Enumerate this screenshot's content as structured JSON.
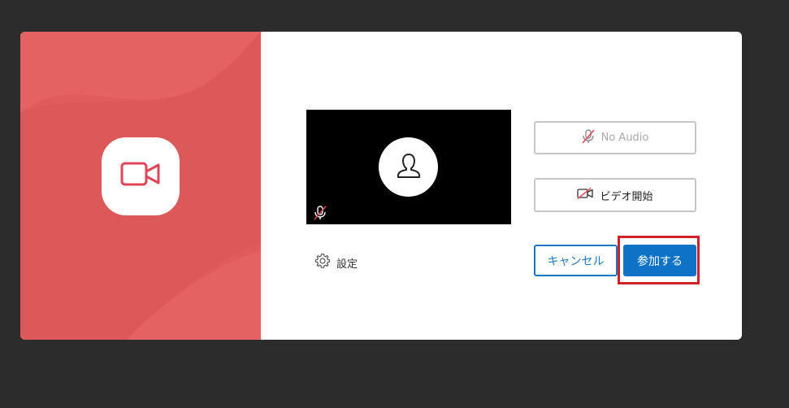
{
  "dialog": {
    "left_panel": {
      "background_color": "#e05c5c",
      "icon": "video-camera-icon"
    },
    "preview": {
      "avatar_icon": "user-silhouette-icon",
      "mic_status_icon": "microphone-muted-icon"
    },
    "audio_button": {
      "label": "No Audio",
      "icon": "microphone-muted-icon"
    },
    "video_button": {
      "label": "ビデオ開始",
      "icon": "video-off-icon"
    },
    "settings": {
      "label": "設定",
      "icon": "gear-icon"
    },
    "cancel_button": {
      "label": "キャンセル"
    },
    "join_button": {
      "label": "参加する"
    }
  },
  "colors": {
    "accent": "#0e72c6",
    "highlight": "#d0212b",
    "brand": "#e05c5c"
  }
}
